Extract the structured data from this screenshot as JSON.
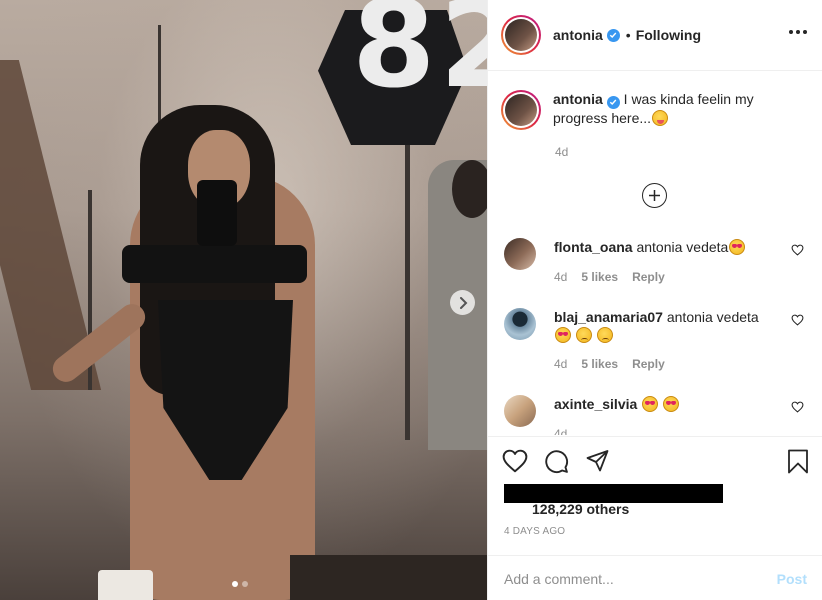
{
  "media": {
    "overlay_number": "82",
    "carousel": {
      "count": 2,
      "active_index": 0
    }
  },
  "post": {
    "username": "antonia",
    "separator": "•",
    "follow_state": "Following",
    "caption": "I was kinda feelin my progress here...",
    "caption_ago": "4d"
  },
  "comments": [
    {
      "username": "flonta_oana",
      "text": "antonia vedeta",
      "ago": "4d",
      "likes": "5 likes",
      "reply": "Reply"
    },
    {
      "username": "blaj_anamaria07",
      "text": "antonia vedeta",
      "ago": "4d",
      "likes": "5 likes",
      "reply": "Reply"
    },
    {
      "username": "axinte_silvia",
      "text": "",
      "ago": "4d",
      "likes": "",
      "reply": ""
    }
  ],
  "footer": {
    "likes_others": "128,229 others",
    "time_ago": "4 DAYS AGO",
    "comment_placeholder": "Add a comment...",
    "post_label": "Post"
  },
  "colors": {
    "verified": "#3897f0",
    "post_button_disabled": "#b2dffc",
    "secondary_text": "#8e8e8e"
  },
  "icons": [
    "more-options-icon",
    "verified-badge-icon",
    "add-circle-icon",
    "heart-icon",
    "comment-icon",
    "share-icon",
    "save-bookmark-icon",
    "chevron-right-icon"
  ]
}
